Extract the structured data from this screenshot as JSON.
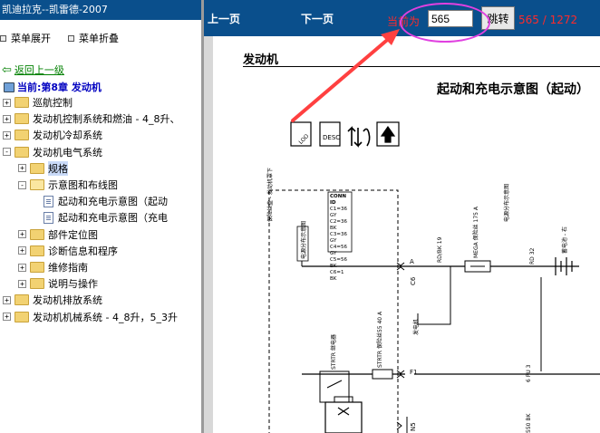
{
  "window": {
    "title": "凯迪拉克--凯雷德-2007"
  },
  "menu": {
    "expand": "菜单展开",
    "collapse": "菜单折叠"
  },
  "nav": {
    "back": "返回上一级",
    "current": "当前:第8章 发动机"
  },
  "tree": [
    {
      "label": "巡航控制",
      "level": 0,
      "type": "folder",
      "expander": "+"
    },
    {
      "label": "发动机控制系统和燃油 - 4_8升、",
      "level": 0,
      "type": "folder",
      "expander": "+"
    },
    {
      "label": "发动机冷却系统",
      "level": 0,
      "type": "folder",
      "expander": "+"
    },
    {
      "label": "发动机电气系统",
      "level": 0,
      "type": "folder",
      "expander": "-"
    },
    {
      "label": "规格",
      "level": 1,
      "type": "folder",
      "expander": "+",
      "selected": true
    },
    {
      "label": "示意图和布线图",
      "level": 1,
      "type": "folder-open",
      "expander": "-"
    },
    {
      "label": "起动和充电示意图（起动",
      "level": 2,
      "type": "doc",
      "expander": ""
    },
    {
      "label": "起动和充电示意图（充电",
      "level": 2,
      "type": "doc",
      "expander": ""
    },
    {
      "label": "部件定位图",
      "level": 1,
      "type": "folder",
      "expander": "+"
    },
    {
      "label": "诊断信息和程序",
      "level": 1,
      "type": "folder",
      "expander": "+"
    },
    {
      "label": "维修指南",
      "level": 1,
      "type": "folder",
      "expander": "+"
    },
    {
      "label": "说明与操作",
      "level": 1,
      "type": "folder",
      "expander": "+"
    },
    {
      "label": "发动机排放系统",
      "level": 0,
      "type": "folder",
      "expander": "+"
    },
    {
      "label": "发动机机械系统 - 4_8升，5_3升",
      "level": 0,
      "type": "folder",
      "expander": "+"
    }
  ],
  "toolbar": {
    "prev": "上一页",
    "next": "下一页",
    "current_label": "当前为",
    "page_value": "565",
    "jump": "跳转",
    "page_count": "565 / 1272"
  },
  "document": {
    "section": "发动机",
    "diagram_title": "起动和充电示意图（起动）",
    "labels": {
      "fuse_top": "保险丝盒 - 发动机罩下",
      "conn_id": "CONN ID",
      "conn_rows": [
        "C1=36 GY",
        "C2=36 BK",
        "C3=36 GY",
        "C4=56 GY",
        "C5=56 BK",
        "C6=1 BK"
      ],
      "power_dist": "电源分布示意图",
      "pin_a": "A",
      "pin_c6": "C6",
      "wire_rdbk": "RD/BK 19",
      "mega": "MEGA 保险丝 175 A",
      "wire_rd": "RD 32",
      "power_dist2": "电源分布示意图",
      "battery": "蓄电池 - 右",
      "pin_f1": "F1",
      "pin_n5": "N5",
      "strtr_relay": "STRTR 继电器",
      "strtr_fuse": "STRTR 保险丝55 40 A",
      "wire_6pu": "6 PU 3",
      "gen": "发电机",
      "wire_550": "550 BK"
    }
  },
  "colors": {
    "toolbar_bg": "#0a4f8c",
    "highlight_red": "#ff2a2a",
    "annotation_arrow": "#ff4040",
    "annotation_ellipse": "#e040e0"
  }
}
